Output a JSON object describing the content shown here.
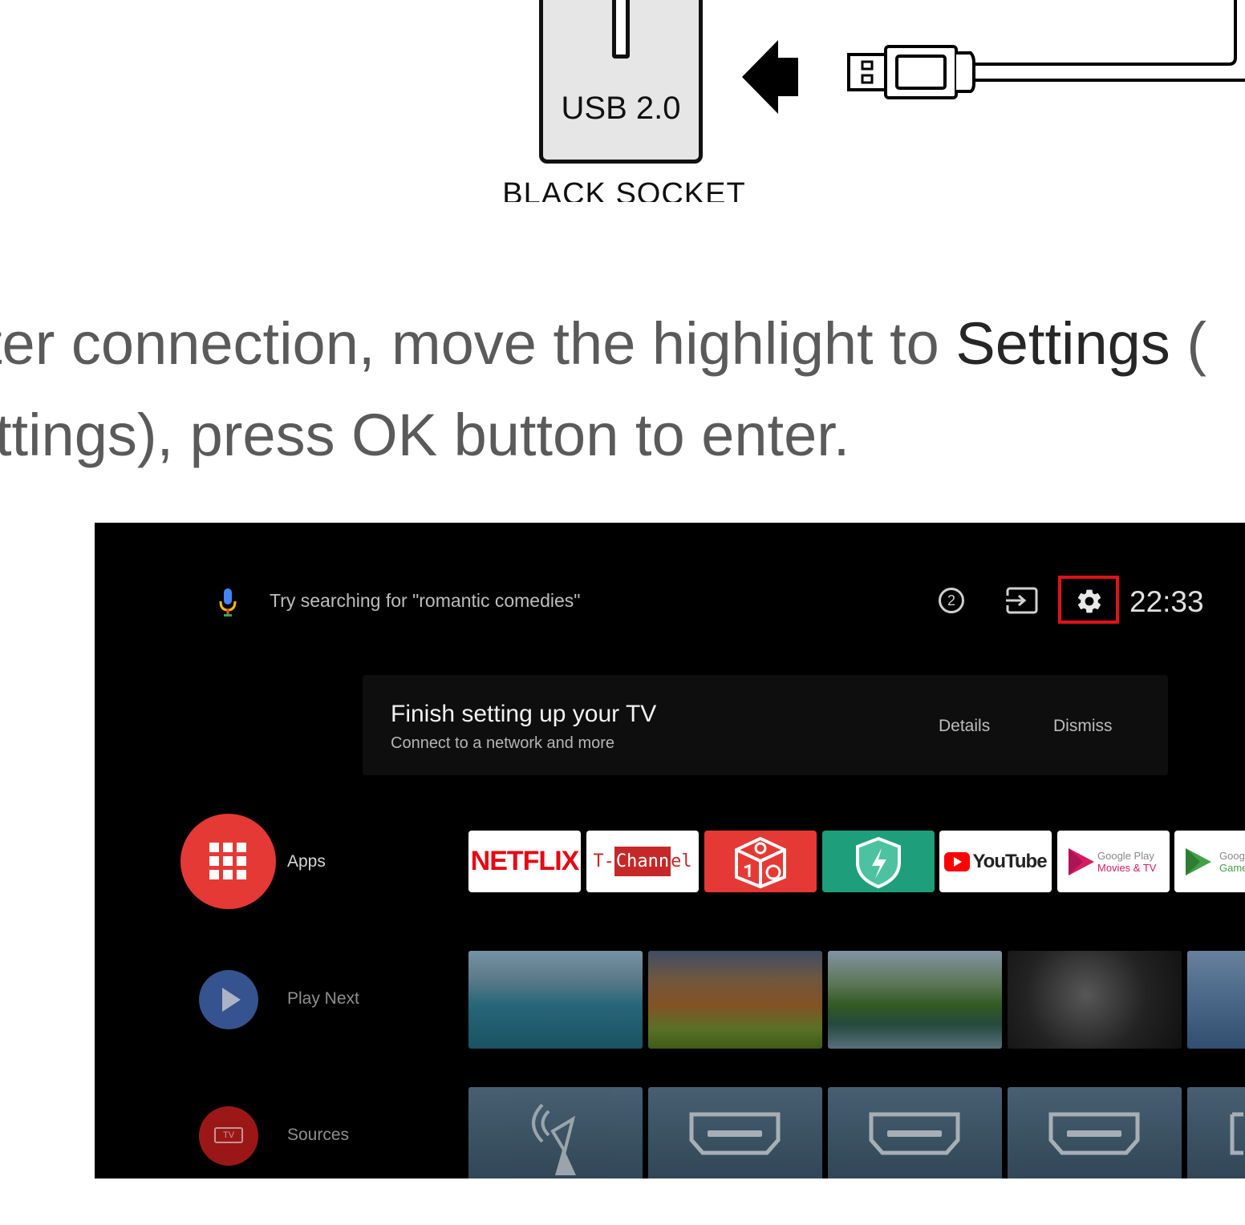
{
  "diagram": {
    "socket_label": "USB 2.0",
    "socket_caption": "BLACK SOCKET"
  },
  "instructions": {
    "line1_pre": "ter connection, move the highlight to ",
    "line1_settings": "Settings",
    "line1_post": " ( ",
    "line2": "ttings), press OK button to enter."
  },
  "tv": {
    "search_placeholder": "Try searching for \"romantic comedies\"",
    "clock": "22:33",
    "notification_badge": "2",
    "notification": {
      "title": "Finish setting up your TV",
      "subtitle": "Connect to a network and more",
      "details_label": "Details",
      "dismiss_label": "Dismiss"
    },
    "rows": {
      "apps_label": "Apps",
      "play_next_label": "Play Next",
      "sources_label": "Sources"
    },
    "apps": {
      "netflix": "NETFLIX",
      "tchannel_a": "T-",
      "tchannel_b": "Chann",
      "tchannel_c": "el",
      "youtube": "YouTube",
      "gplay_movies_1": "Google Play",
      "gplay_movies_2": "Movies & TV",
      "gplay_games_1": "Goog",
      "gplay_games_2": "Game"
    },
    "sources_badge": "TV",
    "colors": {
      "apps_red": "#e53935",
      "play_next_blue": "#3f62a8",
      "sources_red": "#b71c1c",
      "highlight_red": "#e0121a",
      "netflix_red": "#e50914"
    }
  }
}
